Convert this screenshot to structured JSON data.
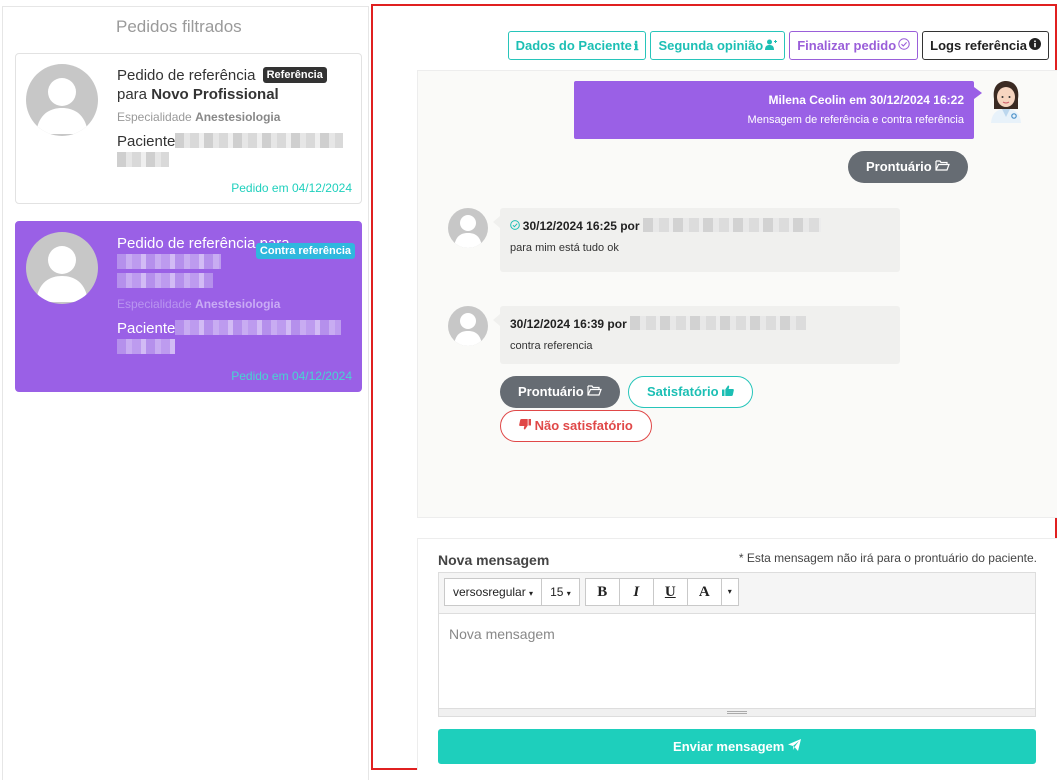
{
  "sidebar": {
    "title": "Pedidos filtrados",
    "cards": [
      {
        "title_prefix": "Pedido de referência",
        "badge": "Referência",
        "title_line2_prefix": "para ",
        "title_target": "Novo Profissional",
        "specialty_label": "Especialidade ",
        "specialty": "Anestesiologia",
        "patient_label": "Paciente",
        "date": "Pedido em 04/12/2024",
        "selected": false
      },
      {
        "title_prefix": "Pedido de referência para",
        "badge": "Contra referência",
        "specialty_label": "Especialidade ",
        "specialty": "Anestesiologia",
        "patient_label": "Paciente",
        "date": "Pedido em 04/12/2024",
        "selected": true
      }
    ]
  },
  "header_buttons": {
    "patient_data": "Dados do Paciente",
    "second_opinion": "Segunda opinião",
    "finish_request": "Finalizar pedido",
    "logs": "Logs referência"
  },
  "messages": {
    "outgoing": {
      "author_line": "Milena Ceolin em 30/12/2024 16:22",
      "text": "Mensagem de referência e contra referência",
      "record_button": "Prontuário"
    },
    "incoming": [
      {
        "header": "30/12/2024 16:25 por",
        "text": "para mim está tudo ok",
        "verified": true
      },
      {
        "header": "30/12/2024 16:39 por",
        "text": "contra referencia",
        "verified": false
      }
    ],
    "actions": {
      "record": "Prontuário",
      "satisfactory": "Satisfatório",
      "unsatisfactory": "Não satisfatório"
    }
  },
  "new_message": {
    "title": "Nova mensagem",
    "note": "* Esta mensagem não irá para o prontuário do paciente.",
    "font_family_select": "versosregular",
    "font_size_select": "15",
    "placeholder": "Nova mensagem",
    "send_button": "Enviar mensagem"
  },
  "colors": {
    "accent_purple": "#9a60e6",
    "accent_teal": "#1ecfbc",
    "danger_red": "#e04848",
    "highlight_border": "#e02020"
  },
  "icons": {
    "patient_data": "info-icon",
    "second_opinion": "user-plus-icon",
    "finish_request": "check-circle-icon",
    "logs": "info-circle-icon",
    "record": "folder-open-icon",
    "satisfactory": "thumbs-up-icon",
    "unsatisfactory": "thumbs-down-icon",
    "send": "paper-plane-icon"
  }
}
